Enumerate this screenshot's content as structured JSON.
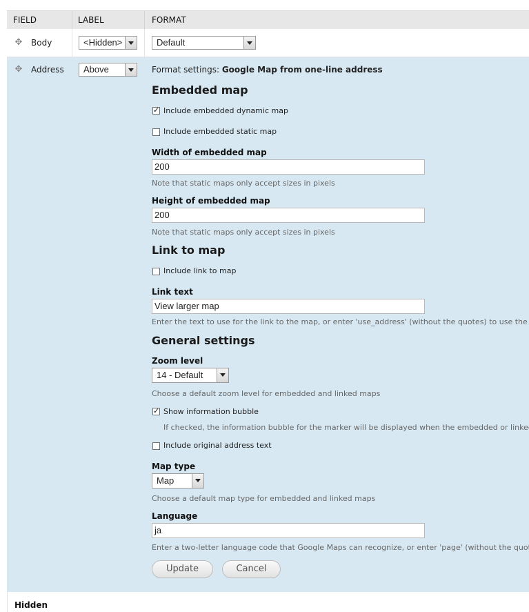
{
  "table": {
    "headers": {
      "field": "FIELD",
      "label": "LABEL",
      "format": "FORMAT"
    }
  },
  "rows": {
    "body": {
      "name": "Body",
      "label_select": "<Hidden>",
      "format_select": "Default"
    },
    "address": {
      "name": "Address",
      "label_select": "Above"
    }
  },
  "format_settings": {
    "prefix": "Format settings:",
    "title": "Google Map from one-line address",
    "embedded_map": {
      "heading": "Embedded map",
      "include_dynamic": {
        "label": "Include embedded dynamic map",
        "checked": true
      },
      "include_static": {
        "label": "Include embedded static map",
        "checked": false
      },
      "width": {
        "label": "Width of embedded map",
        "value": "200",
        "note": "Note that static maps only accept sizes in pixels"
      },
      "height": {
        "label": "Height of embedded map",
        "value": "200",
        "note": "Note that static maps only accept sizes in pixels"
      }
    },
    "link_to_map": {
      "heading": "Link to map",
      "include_link": {
        "label": "Include link to map",
        "checked": false
      },
      "link_text": {
        "label": "Link text",
        "value": "View larger map",
        "note": "Enter the text to use for the link to the map, or enter 'use_address' (without the quotes) to use the ente"
      }
    },
    "general": {
      "heading": "General settings",
      "zoom": {
        "label": "Zoom level",
        "value": "14 - Default",
        "note": "Choose a default zoom level for embedded and linked maps"
      },
      "info_bubble": {
        "label": "Show information bubble",
        "checked": true,
        "note": "If checked, the information bubble for the marker will be displayed when the embedded or linked m"
      },
      "original_text": {
        "label": "Include original address text",
        "checked": false
      },
      "map_type": {
        "label": "Map type",
        "value": "Map",
        "note": "Choose a default map type for embedded and linked maps"
      },
      "language": {
        "label": "Language",
        "value": "ja",
        "note": "Enter a two-letter language code that Google Maps can recognize, or enter 'page' (without the quotes) t"
      }
    },
    "buttons": {
      "update": "Update",
      "cancel": "Cancel"
    }
  },
  "hidden_section": {
    "label": "Hidden"
  },
  "icons": {
    "drag_handle": "move-cross-icon",
    "select_arrow": "chevron-down-icon",
    "checkmark": "check-icon"
  },
  "colors": {
    "settings_bg": "#d7e8f2",
    "header_bg": "#e7e7e7"
  }
}
